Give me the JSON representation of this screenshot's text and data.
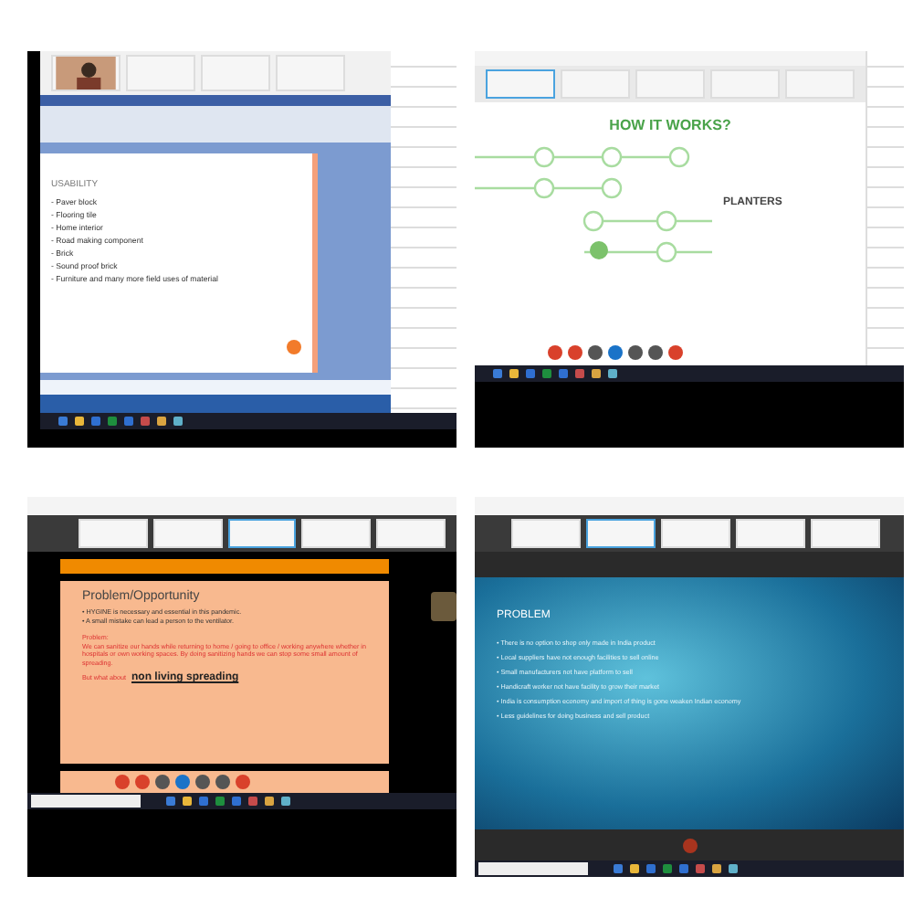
{
  "top_left": {
    "slide": {
      "title": "USABILITY",
      "items": [
        "- Paver block",
        "- Flooring tile",
        "- Home interior",
        "- Road making component",
        "- Brick",
        "- Sound proof brick",
        "- Furniture and many more field uses of material"
      ]
    }
  },
  "top_right": {
    "slide": {
      "title": "HOW IT WORKS?",
      "label": "PLANTERS"
    }
  },
  "bottom_left": {
    "slide": {
      "title": "Problem/Opportunity",
      "bullets": [
        "• HYGINE is necessary and essential in this pandemic.",
        "• A small mistake can lead a person to the ventilator."
      ],
      "problem_label": "Problem:",
      "problem_text": "We can sanitize our hands while returning to home / going to office / working anywhere whether in hospitals or own working spaces. By doing sanitizing hands we can stop some small amount of spreading.",
      "question": "But what about",
      "emphasis": "non living spreading"
    }
  },
  "bottom_right": {
    "slide": {
      "title": "PROBLEM",
      "bullets": [
        "• There is no option to shop only made in India product",
        "• Local suppliers have not enough facilities to sell online",
        "• Small manufacturers not have platform to sell",
        "• Handicraft worker not have facility to grow their market",
        "• India is consumption economy and import of thing is gone weaken Indian economy",
        "• Less guidelines for doing business and sell product"
      ]
    }
  }
}
